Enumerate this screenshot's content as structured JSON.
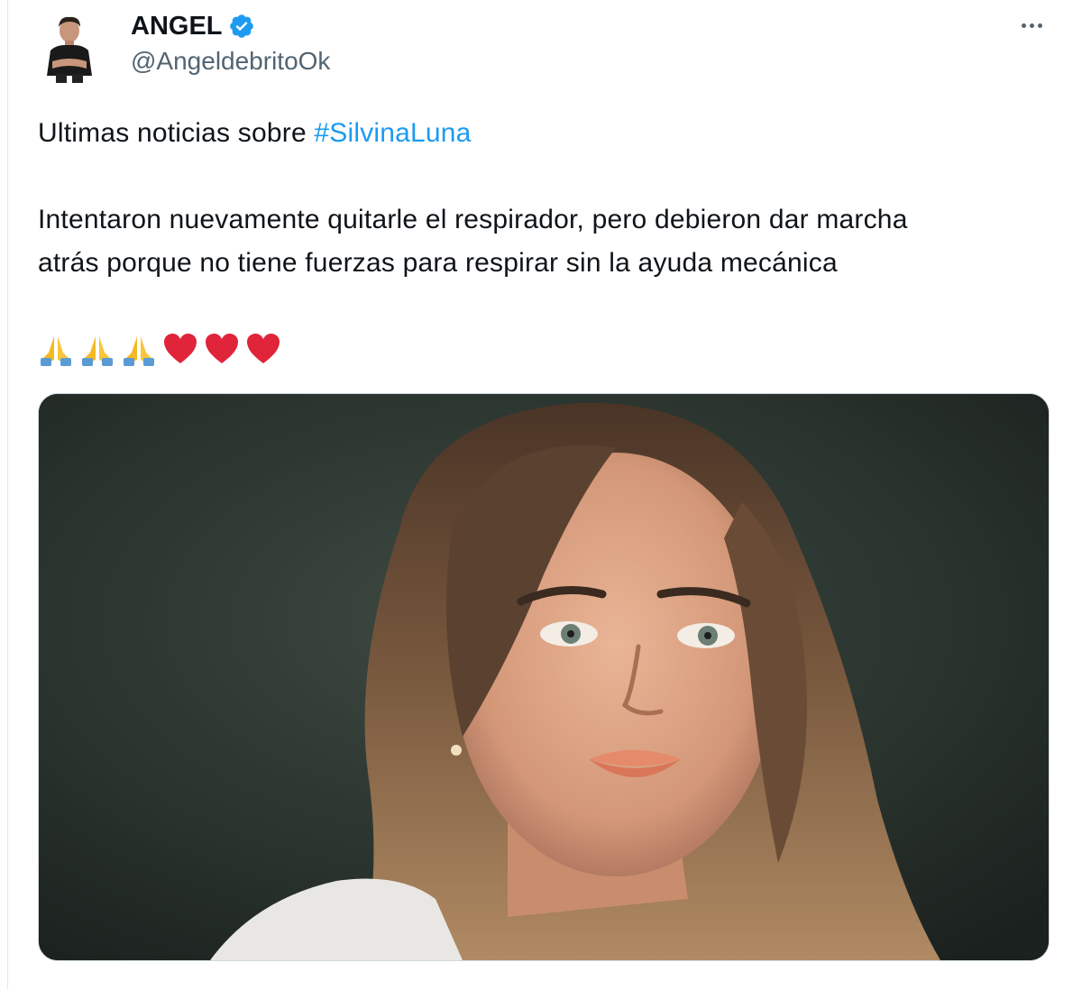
{
  "author": {
    "display_name": "ANGEL",
    "handle": "@AngeldebritoOk",
    "verified": true
  },
  "tweet": {
    "text_prefix": "Ultimas noticias sobre ",
    "hashtag": "#SilvinaLuna",
    "paragraph_line_1": "Intentaron nuevamente quitarle el respirador, pero debieron dar marcha",
    "paragraph_line_2": "atrás porque no tiene fuerzas para respirar sin la ayuda mecánica",
    "emojis": [
      "praying-hands",
      "praying-hands",
      "praying-hands",
      "red-heart",
      "red-heart",
      "red-heart"
    ]
  },
  "icons": {
    "verified": "verified-badge-icon",
    "more": "more-horizontal-icon"
  },
  "colors": {
    "link": "#1d9bf0",
    "verified": "#1d9bf0",
    "text": "#0f1419",
    "secondary_text": "#536471",
    "heart": "#e0243a",
    "photo_background": "#2c3530"
  }
}
